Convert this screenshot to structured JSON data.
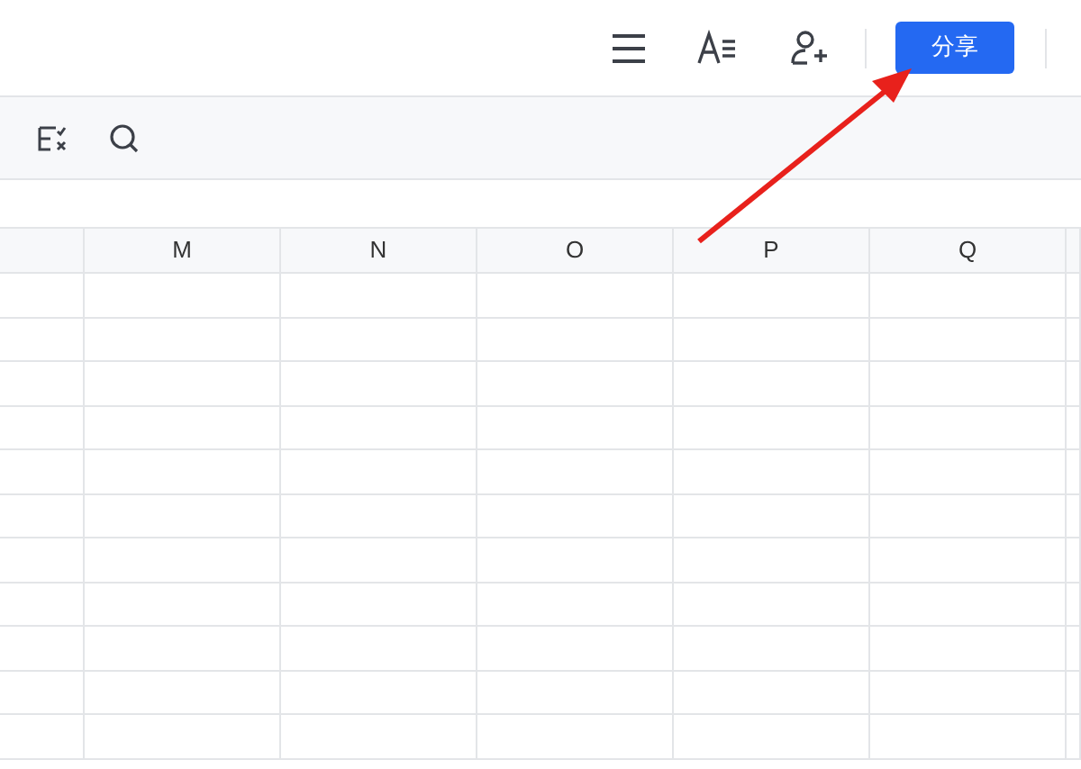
{
  "header": {
    "share_button": "分享"
  },
  "sheet": {
    "columns": [
      "M",
      "N",
      "O",
      "P",
      "Q"
    ]
  }
}
